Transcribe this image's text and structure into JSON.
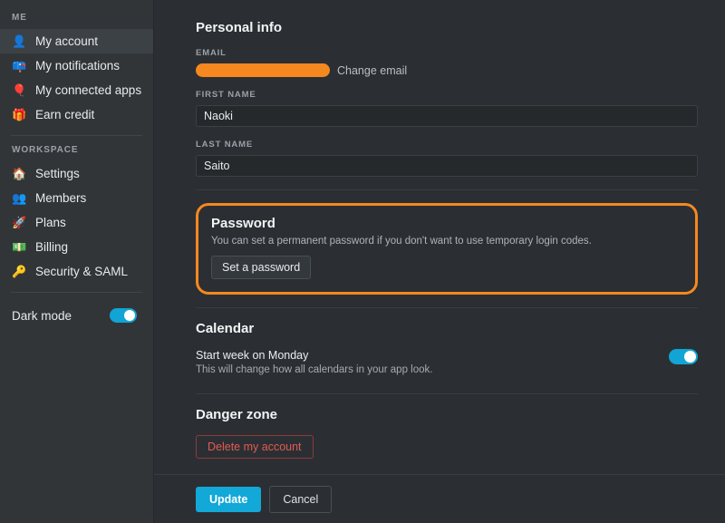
{
  "colors": {
    "accent_highlight": "#f5881f",
    "toggle_on": "#11a4d4",
    "primary_button": "#12a8d8",
    "danger": "#e15b52",
    "sidebar_bg": "#313538",
    "main_bg": "#2b2f33",
    "input_bg": "#26292c"
  },
  "sidebar": {
    "groups": [
      {
        "label": "ME",
        "items": [
          {
            "label": "My account",
            "icon": "person-avatar-icon",
            "glyph": "👤",
            "active": true
          },
          {
            "label": "My notifications",
            "icon": "mailbox-icon",
            "glyph": "📪",
            "active": false
          },
          {
            "label": "My connected apps",
            "icon": "balloon-icon",
            "glyph": "🎈",
            "active": false
          },
          {
            "label": "Earn credit",
            "icon": "gift-icon",
            "glyph": "🎁",
            "active": false
          }
        ]
      },
      {
        "label": "WORKSPACE",
        "items": [
          {
            "label": "Settings",
            "icon": "house-icon",
            "glyph": "🏠",
            "active": false
          },
          {
            "label": "Members",
            "icon": "people-icon",
            "glyph": "👥",
            "active": false
          },
          {
            "label": "Plans",
            "icon": "rocket-icon",
            "glyph": "🚀",
            "active": false
          },
          {
            "label": "Billing",
            "icon": "money-icon",
            "glyph": "💵",
            "active": false
          },
          {
            "label": "Security & SAML",
            "icon": "key-icon",
            "glyph": "🔑",
            "active": false
          }
        ]
      }
    ],
    "dark_mode": {
      "label": "Dark mode",
      "enabled": true
    }
  },
  "main": {
    "personal_info": {
      "title": "Personal info",
      "email": {
        "label": "EMAIL",
        "value": "",
        "redacted": true,
        "change_link": "Change email"
      },
      "first_name": {
        "label": "FIRST NAME",
        "value": "Naoki",
        "placeholder": ""
      },
      "last_name": {
        "label": "LAST NAME",
        "value": "Saito",
        "placeholder": ""
      }
    },
    "password": {
      "title": "Password",
      "description": "You can set a permanent password if you don't want to use temporary login codes.",
      "button": "Set a password",
      "highlighted": true
    },
    "calendar": {
      "title": "Calendar",
      "setting_title": "Start week on Monday",
      "setting_description": "This will change how all calendars in your app look.",
      "enabled": true
    },
    "danger_zone": {
      "title": "Danger zone",
      "button": "Delete my account"
    },
    "actions": {
      "update": "Update",
      "cancel": "Cancel"
    }
  }
}
